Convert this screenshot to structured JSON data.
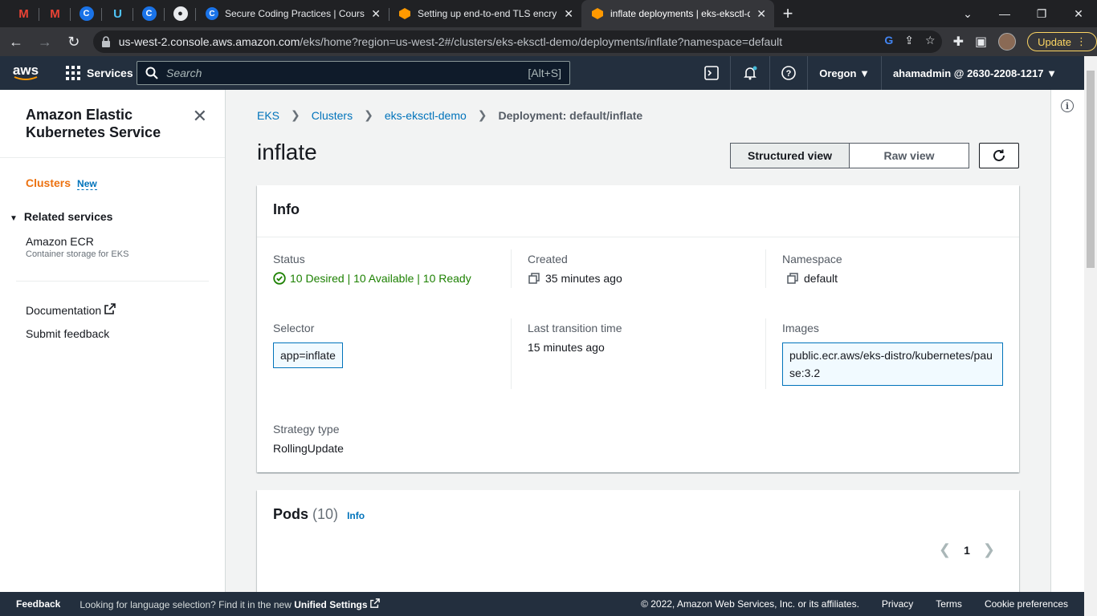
{
  "browser": {
    "tabs": [
      {
        "title": "Secure Coding Practices | Course",
        "favicon": "c-icon"
      },
      {
        "title": "Setting up end-to-end TLS encry",
        "favicon": "aws-icon"
      },
      {
        "title": "inflate deployments | eks-eksctl-d",
        "favicon": "aws-icon",
        "active": true
      }
    ],
    "url_host": "us-west-2.console.aws.amazon.com",
    "url_path": "/eks/home?region=us-west-2#/clusters/eks-eksctl-demo/deployments/inflate?namespace=default",
    "update_label": "Update"
  },
  "awsnav": {
    "logo": "aws",
    "services": "Services",
    "search_placeholder": "Search",
    "search_shortcut": "[Alt+S]",
    "region": "Oregon",
    "account": "ahamadmin @ 2630-2208-1217"
  },
  "sidebar": {
    "title": "Amazon Elastic Kubernetes Service",
    "clusters": "Clusters",
    "new_badge": "New",
    "related": "Related services",
    "ecr": "Amazon ECR",
    "ecr_sub": "Container storage for EKS",
    "documentation": "Documentation",
    "feedback": "Submit feedback"
  },
  "breadcrumb": {
    "eks": "EKS",
    "clusters": "Clusters",
    "cluster": "eks-eksctl-demo",
    "current": "Deployment: default/inflate"
  },
  "page": {
    "title": "inflate",
    "structured": "Structured view",
    "raw": "Raw view"
  },
  "info": {
    "heading": "Info",
    "status_label": "Status",
    "status_value": "10 Desired | 10 Available | 10 Ready",
    "created_label": "Created",
    "created_value": "35 minutes ago",
    "namespace_label": "Namespace",
    "namespace_value": "default",
    "selector_label": "Selector",
    "selector_value": "app=inflate",
    "transition_label": "Last transition time",
    "transition_value": "15 minutes ago",
    "images_label": "Images",
    "images_value": "public.ecr.aws/eks-distro/kubernetes/pause:3.2",
    "strategy_label": "Strategy type",
    "strategy_value": "RollingUpdate"
  },
  "pods": {
    "heading": "Pods",
    "count": "(10)",
    "info": "Info",
    "page": "1"
  },
  "footer": {
    "feedback": "Feedback",
    "lang_text": "Looking for language selection? Find it in the new",
    "lang_link": "Unified Settings",
    "copyright": "© 2022, Amazon Web Services, Inc. or its affiliates.",
    "privacy": "Privacy",
    "terms": "Terms",
    "cookies": "Cookie preferences"
  },
  "colors": {
    "aws_orange": "#ec7211",
    "link_blue": "#0073bb",
    "success_green": "#1d8102",
    "nav_dark": "#232f3e"
  }
}
